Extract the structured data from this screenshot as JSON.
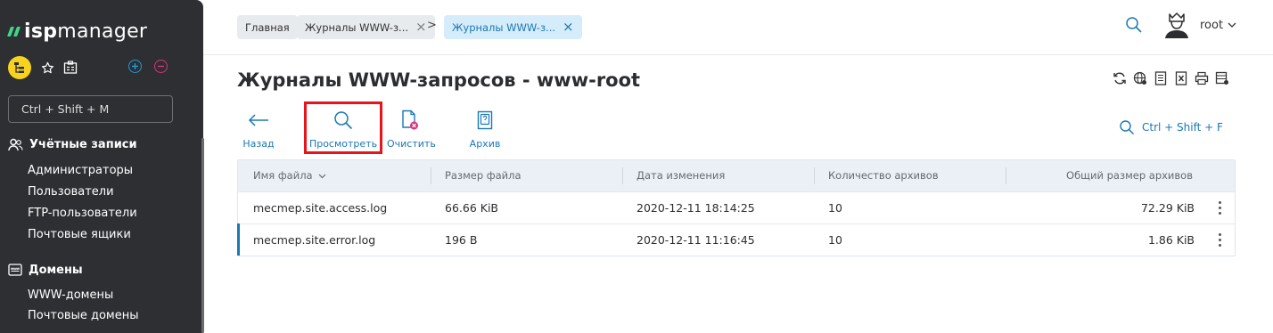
{
  "sidebar": {
    "logo_isp": "isp",
    "logo_manager": "manager",
    "search_placeholder": "Ctrl + Shift + M",
    "sections": [
      {
        "label": "Учётные записи",
        "items": [
          "Администраторы",
          "Пользователи",
          "FTP-пользователи",
          "Почтовые ящики"
        ]
      },
      {
        "label": "Домены",
        "items": [
          "WWW-домены",
          "Почтовые домены"
        ]
      }
    ]
  },
  "topbar": {
    "breadcrumbs": [
      {
        "label": "Главная"
      },
      {
        "label": "Журналы WWW-з..."
      },
      {
        "label": "Журналы WWW-з..."
      }
    ],
    "separator": ">",
    "user": "root"
  },
  "page": {
    "title": "Журналы WWW-запросов - www-root",
    "toolbar": {
      "back": "Назад",
      "view": "Просмотреть",
      "clear": "Очистить",
      "archive": "Архив"
    },
    "table_search": "Ctrl + Shift + F"
  },
  "table": {
    "columns": [
      "Имя файла",
      "Размер файла",
      "Дата изменения",
      "Количество архивов",
      "Общий размер архивов"
    ],
    "sort_indicator": "⌵",
    "rows": [
      {
        "name": "mecmep.site.access.log",
        "size": "66.66 KiB",
        "modified": "2020-12-11 18:14:25",
        "archives": "10",
        "archives_size": "72.29 KiB"
      },
      {
        "name": "mecmep.site.error.log",
        "size": "196 B",
        "modified": "2020-12-11 11:16:45",
        "archives": "10",
        "archives_size": "1.86 KiB"
      }
    ]
  },
  "colors": {
    "accent": "#1b78b5",
    "sidebar_bg": "#2d2f33",
    "logo_green": "#3fd68a",
    "highlight_red": "#e8141b"
  }
}
